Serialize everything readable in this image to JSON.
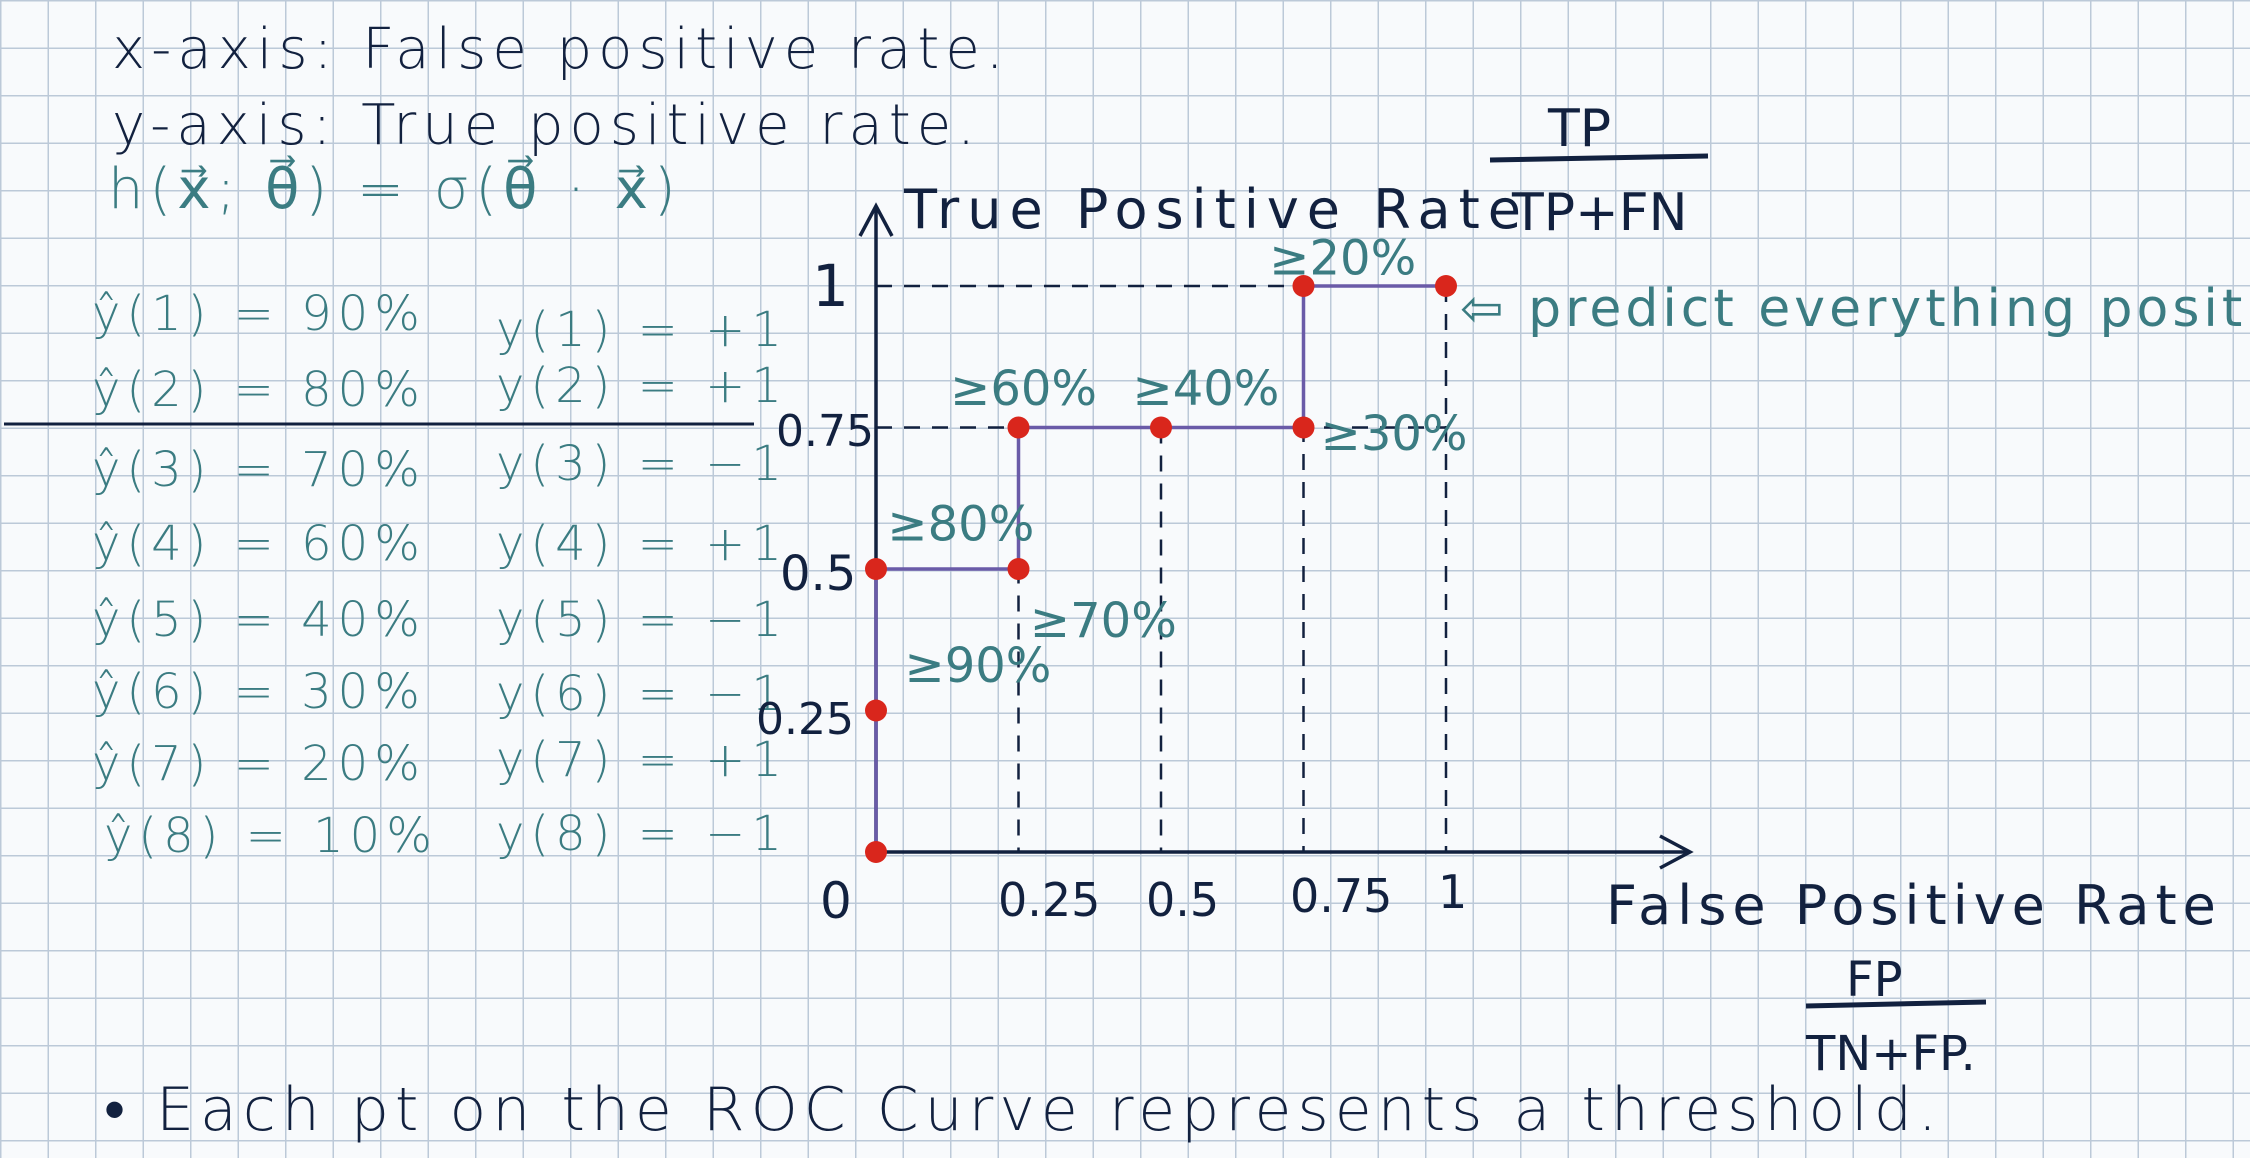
{
  "header": {
    "line_x": "x-axis: False positive rate.",
    "line_y": "y-axis: True positive rate.",
    "formula": "h(x⃗; θ⃗) = σ(θ⃗ · x⃗)"
  },
  "predictions": [
    {
      "pred": "ŷ(1) = 90%",
      "label": "y(1) = +1"
    },
    {
      "pred": "ŷ(2) = 80%",
      "label": "y(2) = +1"
    },
    {
      "pred": "ŷ(3) = 70%",
      "label": "y(3) = −1"
    },
    {
      "pred": "ŷ(4) = 60%",
      "label": "y(4) = +1"
    },
    {
      "pred": "ŷ(5) = 40%",
      "label": "y(5) = −1"
    },
    {
      "pred": "ŷ(6) = 30%",
      "label": "y(6) = −1"
    },
    {
      "pred": "ŷ(7) = 20%",
      "label": "y(7) = +1"
    },
    {
      "pred": "ŷ(8) = 10%",
      "label": "y(8) = −1"
    }
  ],
  "tpr_formula": {
    "numerator": "TP",
    "denominator": "TP+FN"
  },
  "fpr_formula": {
    "numerator": "FP",
    "denominator": "TN+FP."
  },
  "chart_data": {
    "type": "line",
    "xlabel": "False Positive Rate",
    "ylabel": "True Positive Rate",
    "xlim": [
      0,
      1
    ],
    "ylim": [
      0,
      1
    ],
    "x_ticks": [
      "0",
      "0.25",
      "0.5",
      "0.75",
      "1"
    ],
    "y_ticks": [
      "0.25",
      "0.5",
      "0.75",
      "1"
    ],
    "curve": [
      {
        "x": 0,
        "y": 0
      },
      {
        "x": 0,
        "y": 0.5
      },
      {
        "x": 0.25,
        "y": 0.5
      },
      {
        "x": 0.25,
        "y": 0.75
      },
      {
        "x": 0.75,
        "y": 0.75
      },
      {
        "x": 0.75,
        "y": 1
      },
      {
        "x": 1,
        "y": 1
      }
    ],
    "points": [
      {
        "x": 0,
        "y": 0
      },
      {
        "x": 0,
        "y": 0.25
      },
      {
        "x": 0,
        "y": 0.5
      },
      {
        "x": 0.25,
        "y": 0.5
      },
      {
        "x": 0.25,
        "y": 0.75
      },
      {
        "x": 0.5,
        "y": 0.75
      },
      {
        "x": 0.75,
        "y": 0.75
      },
      {
        "x": 0.75,
        "y": 1
      },
      {
        "x": 1,
        "y": 1
      }
    ],
    "threshold_labels": [
      {
        "text": "≥90%",
        "x": 0.05,
        "y": 0.3
      },
      {
        "text": "≥80%",
        "x": 0.02,
        "y": 0.55
      },
      {
        "text": "≥70%",
        "x": 0.27,
        "y": 0.38
      },
      {
        "text": "≥60%",
        "x": 0.13,
        "y": 0.79
      },
      {
        "text": "≥40%",
        "x": 0.45,
        "y": 0.79
      },
      {
        "text": "≥30%",
        "x": 0.78,
        "y": 0.71
      },
      {
        "text": "≥20%",
        "x": 0.69,
        "y": 1.02
      }
    ],
    "annotation": "⇦ predict everything positive",
    "colors": {
      "axis": "#12213f",
      "curve": "#6a5ba8",
      "points": "#d9261c",
      "labels": "#3b7c82"
    }
  },
  "footer": "• Each pt on the ROC Curve represents a threshold."
}
